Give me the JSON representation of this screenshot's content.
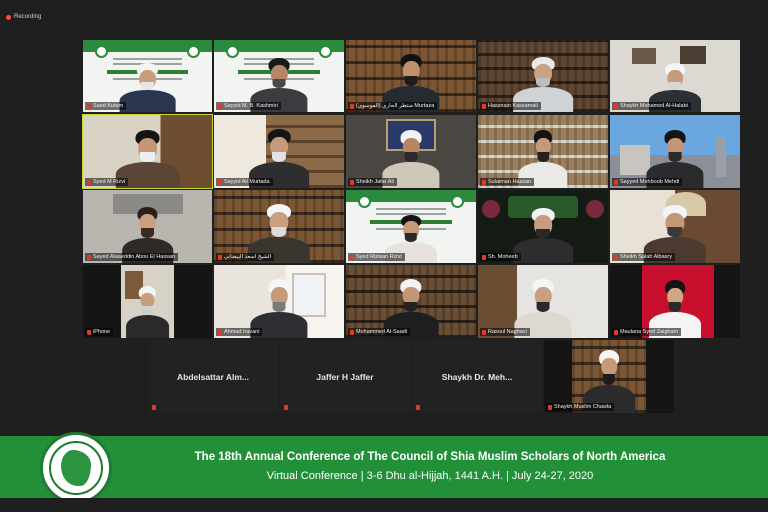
{
  "recording": {
    "label": "Recording"
  },
  "tiles": {
    "t1": {
      "name": "Saed Kutam"
    },
    "t2": {
      "name": "Sayyid M. B. Kashmiri"
    },
    "t3": {
      "name": "منتظر الحاري (الموسوي) Murtaza"
    },
    "t4": {
      "name": "Hassnain Kassamali"
    },
    "t5": {
      "name": "Shaykh Mohamed Al-Halabi"
    },
    "t6": {
      "name": "Syed M Rizvi"
    },
    "t7": {
      "name": "Sayyid Ali Murtada"
    },
    "t8": {
      "name": "Sheikh Jafar Ali"
    },
    "t9": {
      "name": "Sulaiman Hassan"
    },
    "t10": {
      "name": "Sayyed Mehboob Mehdi"
    },
    "t11": {
      "name": "Sayed Alaaeddin Abou El Hassan"
    },
    "t12": {
      "name": "الشيخ اسعد البيضاني"
    },
    "t13": {
      "name": "Syed Rizwan Rizvi"
    },
    "t14": {
      "name": "Sh. Moheeb"
    },
    "t15": {
      "name": "Sheikh Salah Albasry"
    },
    "t16": {
      "name": "iPhone"
    },
    "t17": {
      "name": "Ahmad Iravani"
    },
    "t18": {
      "name": "Mohammed Al-Saadi"
    },
    "t19": {
      "name": "Rasoul Naghavi"
    },
    "t20": {
      "name": "Maulana Syed Zaigham"
    },
    "t21": {
      "name": "Abdelsattar Alm..."
    },
    "t22": {
      "name": "Jaffer H Jaffer"
    },
    "t23": {
      "name": "Shaykh Dr. Meh..."
    },
    "t24": {
      "name": "Shaykh Muslim Chawla"
    }
  },
  "footer": {
    "title": "The 18th Annual Conference of The Council of Shia Muslim Scholars of North America",
    "subtitle": "Virtual Conference | 3-6 Dhu al-Hijjah, 1441 A.H. | July 24-27, 2020"
  },
  "colors": {
    "accent": "#229039",
    "active_outline": "#c8d63a",
    "mic": "#e23a2a"
  }
}
